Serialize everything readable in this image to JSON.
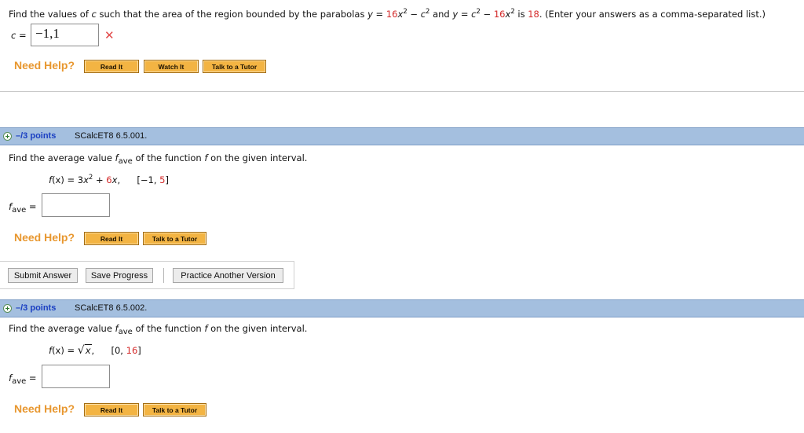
{
  "q_top": {
    "prompt_prefix": "Find the values of ",
    "var_c": "c",
    "prompt_mid1": " such that the area of the region bounded by the parabolas ",
    "y_eq1": "y = ",
    "coef1": "16",
    "x1": "x",
    "exp1": "2",
    "minus1": " − ",
    "c1": "c",
    "exp2": "2",
    "and": " and ",
    "y_eq2": "y = ",
    "c2": "c",
    "exp3": "2",
    "minus2": " − ",
    "coef2": "16",
    "x2": "x",
    "exp4": "2",
    "is": " is ",
    "area": "18",
    "prompt_suffix": ". (Enter your answers as a comma-separated list.)",
    "answer_label": "c = ",
    "answer_value": "−1,1",
    "incorrect_mark": "✕"
  },
  "help": {
    "need_help": "Need Help?",
    "read_it": "Read It",
    "watch_it": "Watch It",
    "talk_to_tutor": "Talk to a Tutor"
  },
  "question1": {
    "points": "–/3 points",
    "id": "SCalcET8 6.5.001.",
    "prompt_a": "Find the average value ",
    "f_ave": "f",
    "ave_sub": "ave",
    "prompt_b": " of the function ",
    "f": "f",
    "prompt_c": " on the given interval.",
    "fx": "f",
    "fx_rest1": "(x) = 3",
    "fx_x": "x",
    "fx_exp": "2",
    "fx_plus": " + ",
    "fx_coef": "6",
    "fx_x2": "x",
    "fx_comma": ",",
    "interval_open": "[−1, ",
    "interval_end": "5",
    "interval_close": "]",
    "answer_label_f": "f",
    "answer_label_sub": "ave",
    "answer_label_eq": " =",
    "answer_value": ""
  },
  "actions": {
    "submit": "Submit Answer",
    "save": "Save Progress",
    "practice": "Practice Another Version"
  },
  "question2": {
    "points": "–/3 points",
    "id": "SCalcET8 6.5.002.",
    "prompt_a": "Find the average value ",
    "f_ave": "f",
    "ave_sub": "ave",
    "prompt_b": " of the function ",
    "f": "f",
    "prompt_c": " on the given interval.",
    "fx": "f",
    "fx_rest": "(x) = ",
    "sqrt_sym": "√",
    "sqrt_x": "x",
    "fx_comma": ",",
    "interval_open": "[0, ",
    "interval_end": "16",
    "interval_close": "]",
    "answer_label_f": "f",
    "answer_label_sub": "ave",
    "answer_label_eq": " =",
    "answer_value": ""
  }
}
